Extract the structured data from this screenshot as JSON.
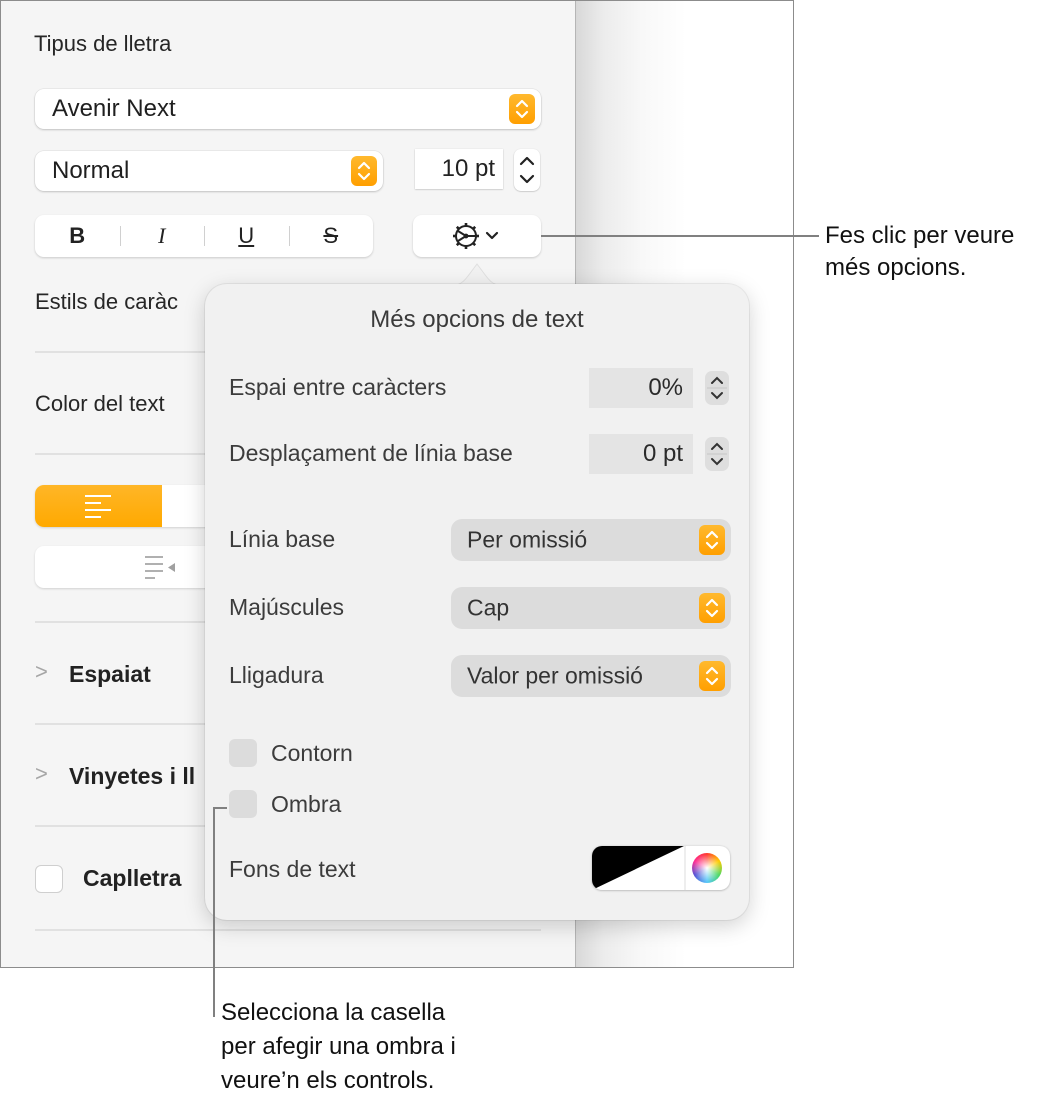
{
  "sidebar": {
    "font_section_title": "Tipus de lletra",
    "font_family": "Avenir Next",
    "font_style": "Normal",
    "font_size": "10 pt",
    "format_buttons": [
      {
        "name": "bold",
        "label": "B"
      },
      {
        "name": "italic",
        "label": "I"
      },
      {
        "name": "underline",
        "label": "U"
      },
      {
        "name": "strikethrough",
        "label": "S"
      }
    ],
    "advanced_options_icon": "gear-with-chevron-icon",
    "character_styles_label": "Estils de caràc",
    "text_color_label": "Color del text",
    "alignment_selected": "align-left",
    "indent_icon": "outdent-icon",
    "spacing_label": "Espaiat",
    "bullets_label": "Vinyetes i ll",
    "dropcap_label": "Caplletra",
    "dropcap_checked": false
  },
  "popover": {
    "title": "Més opcions de text",
    "character_spacing_label": "Espai entre caràcters",
    "character_spacing_value": "0%",
    "baseline_shift_label": "Desplaçament de línia base",
    "baseline_shift_value": "0 pt",
    "baseline_label": "Línia base",
    "baseline_value": "Per omissió",
    "capitalization_label": "Majúscules",
    "capitalization_value": "Cap",
    "ligatures_label": "Lligadura",
    "ligatures_value": "Valor per omissió",
    "outline_label": "Contorn",
    "outline_checked": false,
    "shadow_label": "Ombra",
    "shadow_checked": false,
    "text_background_label": "Fons de text"
  },
  "callouts": {
    "more_options_line1": "Fes clic per veure",
    "more_options_line2": "més opcions.",
    "shadow_line1": "Selecciona la casella",
    "shadow_line2": "per afegir una ombra i",
    "shadow_line3": "veure’n els controls."
  },
  "colors": {
    "accent": "#FFA500",
    "sidebar_bg": "#F5F5F5",
    "popover_bg": "#F1F1F1"
  }
}
